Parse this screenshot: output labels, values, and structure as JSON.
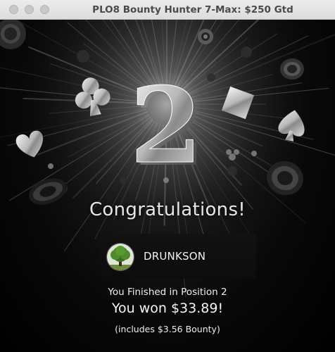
{
  "window": {
    "title": "PLO8 Bounty Hunter 7-Max: $250 Gtd"
  },
  "result": {
    "position_digit": "2",
    "headline": "Congratulations!",
    "player_name": "DRUNKSON",
    "finish_line": "You Finished in Position 2",
    "winnings_line": "You won $33.89!",
    "bounty_line": "(includes $3.56 Bounty)"
  },
  "icons": [
    "club-icon",
    "heart-icon",
    "diamond-icon",
    "spade-icon",
    "poker-chip-icon",
    "tree-avatar-icon"
  ],
  "colors": {
    "background": "#000000",
    "title_bar": "#e4e4e4",
    "text": "#f0f0f0"
  }
}
